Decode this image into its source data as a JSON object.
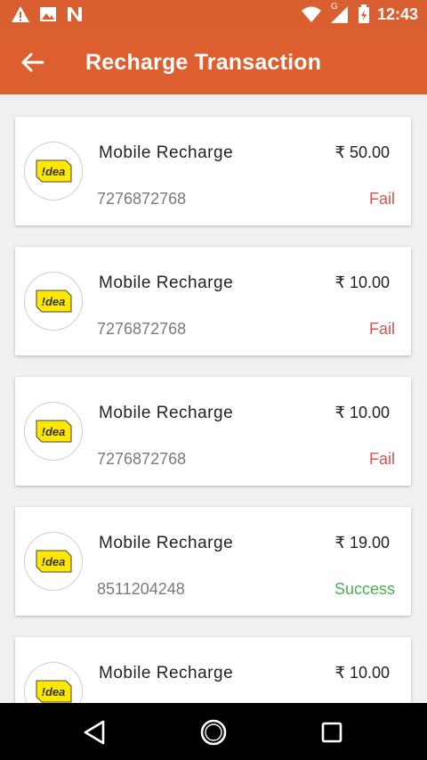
{
  "statusbar": {
    "time": "12:43",
    "network_label": "G"
  },
  "appbar": {
    "title": "Recharge Transaction"
  },
  "operator_logo_text": "!dea",
  "transactions": [
    {
      "name": "Mobile Recharge",
      "amount": "₹ 50.00",
      "number": "7276872768",
      "status": "Fail"
    },
    {
      "name": "Mobile Recharge",
      "amount": "₹ 10.00",
      "number": "7276872768",
      "status": "Fail"
    },
    {
      "name": "Mobile Recharge",
      "amount": "₹ 10.00",
      "number": "7276872768",
      "status": "Fail"
    },
    {
      "name": "Mobile Recharge",
      "amount": "₹ 19.00",
      "number": "8511204248",
      "status": "Success"
    },
    {
      "name": "Mobile Recharge",
      "amount": "₹ 10.00"
    }
  ],
  "colors": {
    "accent": "#dd5f30",
    "fail": "#d9534f",
    "success": "#4caf50"
  }
}
